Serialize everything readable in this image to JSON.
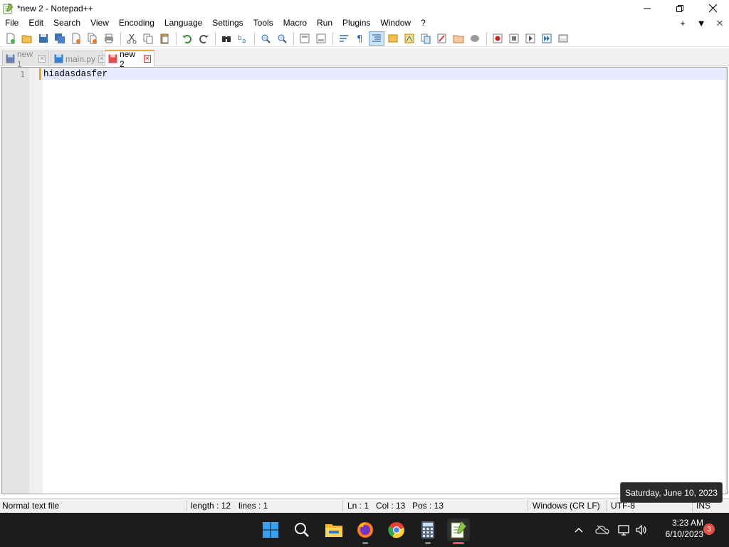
{
  "window": {
    "title": "*new 2 - Notepad++"
  },
  "menu": {
    "items": [
      "File",
      "Edit",
      "Search",
      "View",
      "Encoding",
      "Language",
      "Settings",
      "Tools",
      "Macro",
      "Run",
      "Plugins",
      "Window",
      "?"
    ],
    "right": {
      "add": "+",
      "dropdown": "▼",
      "close": "✕"
    }
  },
  "tabs": [
    {
      "label": "new 1",
      "active": false
    },
    {
      "label": "main.py",
      "active": false
    },
    {
      "label": "new 2",
      "active": true
    }
  ],
  "editor": {
    "lines": [
      {
        "number": "1",
        "text": "hiadasdasfer"
      }
    ]
  },
  "status": {
    "file_type": "Normal text file",
    "length": "length : 12",
    "lines": "lines : 1",
    "ln": "Ln : 1",
    "col": "Col : 13",
    "pos": "Pos : 13",
    "eol": "Windows (CR LF)",
    "encoding": "UTF-8",
    "mode": "INS"
  },
  "tooltip": {
    "text": "Saturday, June 10, 2023"
  },
  "taskbar": {
    "apps": [
      "start-icon",
      "search-icon",
      "file-explorer-icon",
      "firefox-icon",
      "chrome-icon",
      "calculator-icon",
      "notepad-plus-plus-icon"
    ],
    "clock_time": "3:23 AM",
    "clock_date": "6/10/2023",
    "notification_count": "3"
  },
  "colors": {
    "accent_tab": "#f5a623",
    "current_line": "#e8e8ff",
    "taskbar": "#1c1c1c",
    "badge": "#e0524a"
  }
}
